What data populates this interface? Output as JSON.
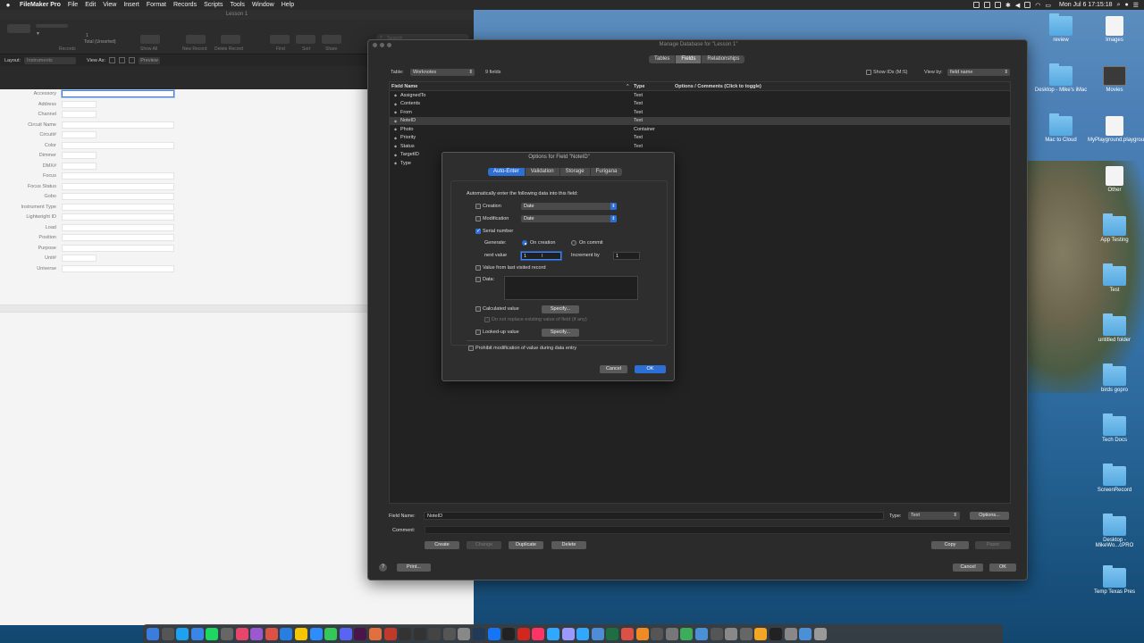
{
  "menubar": {
    "apple": "",
    "items": [
      "FileMaker Pro",
      "File",
      "Edit",
      "View",
      "Insert",
      "Format",
      "Records",
      "Scripts",
      "Tools",
      "Window",
      "Help"
    ],
    "clock": "Mon Jul 6  17:15:18"
  },
  "fm_window": {
    "title": "Lesson 1",
    "toolbar": {
      "records_label": "Records",
      "record_num": "1",
      "total_label": "Total (Unsorted)",
      "show_all": "Show All",
      "new_record": "New Record",
      "delete_record": "Delete Record",
      "find": "Find",
      "sort": "Sort",
      "share": "Share",
      "search_placeholder": "Search"
    },
    "layoutbar": {
      "layout_label": "Layout:",
      "layout_value": "Instruments",
      "view_as": "View As:",
      "preview": "Preview"
    },
    "fields": [
      {
        "label": "Accessory",
        "wide": true
      },
      {
        "label": "Address",
        "wide": false
      },
      {
        "label": "Channel",
        "wide": false
      },
      {
        "label": "Circuit Name",
        "wide": true
      },
      {
        "label": "Circuit#",
        "wide": false
      },
      {
        "label": "Color",
        "wide": true
      },
      {
        "label": "Dimmer",
        "wide": false
      },
      {
        "label": "DMX#",
        "wide": false
      },
      {
        "label": "Focus",
        "wide": true
      },
      {
        "label": "Focus Status",
        "wide": true
      },
      {
        "label": "Gobo",
        "wide": true
      },
      {
        "label": "Instrument Type",
        "wide": true
      },
      {
        "label": "Lightwright ID",
        "wide": true
      },
      {
        "label": "Load",
        "wide": true
      },
      {
        "label": "Position",
        "wide": true
      },
      {
        "label": "Purpose",
        "wide": true
      },
      {
        "label": "Unit#",
        "wide": false
      },
      {
        "label": "Universe",
        "wide": true
      }
    ]
  },
  "manage_db": {
    "title": "Manage Database for \"Lesson 1\"",
    "tabs": [
      "Tables",
      "Fields",
      "Relationships"
    ],
    "active_tab": "Fields",
    "table_label": "Table:",
    "table_value": "Worknotes",
    "field_count": "9 fields",
    "show_ids": "Show IDs (M:S)",
    "view_by_label": "View by:",
    "view_by_value": "field name",
    "columns": {
      "name": "Field Name",
      "type": "Type",
      "options": "Options / Comments   (Click to toggle)"
    },
    "rows": [
      {
        "name": "AssignedTo",
        "type": "Text"
      },
      {
        "name": "Contents",
        "type": "Text"
      },
      {
        "name": "From",
        "type": "Text"
      },
      {
        "name": "NoteID",
        "type": "Text"
      },
      {
        "name": "Photo",
        "type": "Container"
      },
      {
        "name": "Priority",
        "type": "Text"
      },
      {
        "name": "Status",
        "type": "Text"
      },
      {
        "name": "TargetID",
        "type": "Text"
      },
      {
        "name": "Type",
        "type": ""
      }
    ],
    "selected_row": 3,
    "field_name_label": "Field Name:",
    "field_name_value": "NoteID",
    "type_label": "Type:",
    "type_value": "Text",
    "options_btn": "Options...",
    "comment_label": "Comment:",
    "create": "Create",
    "change": "Change",
    "duplicate": "Duplicate",
    "delete": "Delete",
    "copy": "Copy",
    "paste": "Paste",
    "print": "Print...",
    "cancel": "Cancel",
    "ok": "OK"
  },
  "options_dialog": {
    "title": "Options for Field \"NoteID\"",
    "tabs": [
      "Auto-Enter",
      "Validation",
      "Storage",
      "Furigana"
    ],
    "active_tab": "Auto-Enter",
    "intro": "Automatically enter the following data into this field:",
    "creation": "Creation",
    "creation_value": "Date",
    "modification": "Modification",
    "modification_value": "Date",
    "serial": "Serial number",
    "generate": "Generate:",
    "on_creation": "On creation",
    "on_commit": "On commit",
    "next_value_label": "next value",
    "next_value": "1",
    "increment_label": "Increment by",
    "increment_value": "1",
    "last_visited": "Value from last visited record",
    "data": "Data:",
    "calculated": "Calculated value",
    "specify": "Specify...",
    "do_not_replace": "Do not replace existing value of field (if any)",
    "looked_up": "Looked-up value",
    "prohibit": "Prohibit modification of value during data entry",
    "cancel": "Cancel",
    "ok": "OK"
  },
  "desktop_icons": [
    {
      "label": "review",
      "kind": "folder"
    },
    {
      "label": "Images",
      "kind": "doc"
    },
    {
      "label": "Desktop - Mike's iMac",
      "kind": "folder"
    },
    {
      "label": "Movies",
      "kind": "dark"
    },
    {
      "label": "Mac to Cloud",
      "kind": "folder"
    },
    {
      "label": "MyPlayground.playground",
      "kind": "doc"
    },
    {
      "label": "Other",
      "kind": "doc"
    },
    {
      "label": "App Testing",
      "kind": "folder"
    },
    {
      "label": "Test",
      "kind": "folder"
    },
    {
      "label": "untitled folder",
      "kind": "folder"
    },
    {
      "label": "birds gopro",
      "kind": "folder"
    },
    {
      "label": "Tech Docs",
      "kind": "folder"
    },
    {
      "label": "ScreenRecord",
      "kind": "folder"
    },
    {
      "label": "Desktop - MikeWo...cPRO",
      "kind": "folder"
    },
    {
      "label": "Temp Texas Pres",
      "kind": "folder"
    }
  ],
  "dock": {
    "apps": [
      "Finder",
      "Siri",
      "Twitter",
      "Mail",
      "Spotify",
      "Power",
      "Music",
      "Podcasts",
      "Chrome",
      "Safari",
      "Notes",
      "Zoom",
      "Messages",
      "Discord",
      "Slack",
      "Photos",
      "Photo Booth",
      "Clock",
      "Clock2",
      "MA",
      "V",
      "Help",
      "Lightroom",
      "Xcode",
      "Terminal",
      "Acrobat",
      "InDesign",
      "Photoshop",
      "Premiere",
      "Lightroom Classic",
      "Preview",
      "Excel",
      "Chrome2",
      "VLC",
      "Compressor",
      "Automator",
      "Maps",
      "Files",
      "Calculator",
      "Settings",
      "Audio",
      "Pages",
      "Terminal2",
      "Trash",
      "Downloads",
      "Trash2"
    ],
    "colors": [
      "#3b7ddd",
      "#555",
      "#1da1f2",
      "#3a86e8",
      "#1ed760",
      "#666",
      "#e9446a",
      "#9b59d0",
      "#dd5144",
      "#2a7de1",
      "#f5c500",
      "#2d8cff",
      "#34c759",
      "#5865f2",
      "#4a154b",
      "#e36f3c",
      "#c0392b",
      "#333",
      "#333",
      "#444",
      "#555",
      "#888",
      "#1f3b57",
      "#1575f9",
      "#222",
      "#d3271e",
      "#ff3366",
      "#31a8ff",
      "#9999ff",
      "#31a8ff",
      "#4e8cd8",
      "#1d6f42",
      "#dd5144",
      "#f08a24",
      "#555",
      "#777",
      "#3dad5b",
      "#4b8fd6",
      "#555",
      "#888",
      "#666",
      "#f5a623",
      "#222",
      "#888",
      "#4b8fd6",
      "#999"
    ]
  }
}
